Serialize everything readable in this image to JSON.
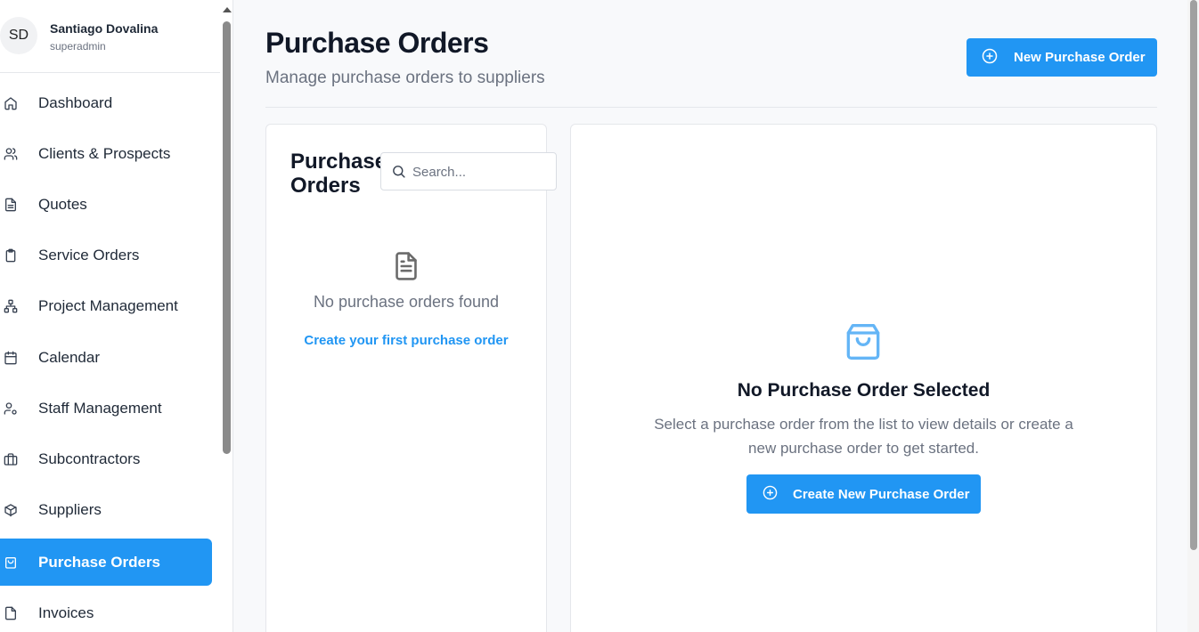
{
  "user": {
    "initials": "SD",
    "name": "Santiago Dovalina",
    "role": "superadmin"
  },
  "nav": [
    {
      "label": "Dashboard",
      "icon": "home-icon",
      "active": false
    },
    {
      "label": "Clients & Prospects",
      "icon": "users-icon",
      "active": false
    },
    {
      "label": "Quotes",
      "icon": "file-text-icon",
      "active": false
    },
    {
      "label": "Service Orders",
      "icon": "clipboard-icon",
      "active": false
    },
    {
      "label": "Project Management",
      "icon": "sitemap-icon",
      "active": false
    },
    {
      "label": "Calendar",
      "icon": "calendar-icon",
      "active": false
    },
    {
      "label": "Staff Management",
      "icon": "user-cog-icon",
      "active": false
    },
    {
      "label": "Subcontractors",
      "icon": "briefcase-icon",
      "active": false
    },
    {
      "label": "Suppliers",
      "icon": "package-icon",
      "active": false
    },
    {
      "label": "Purchase Orders",
      "icon": "shopping-bag-icon",
      "active": true
    },
    {
      "label": "Invoices",
      "icon": "file-icon",
      "active": false
    }
  ],
  "header": {
    "title": "Purchase Orders",
    "subtitle": "Manage purchase orders to suppliers",
    "new_button": "New Purchase Order"
  },
  "list": {
    "title": "Purchase Orders",
    "search_placeholder": "Search...",
    "empty_text": "No purchase orders found",
    "create_link": "Create your first purchase order"
  },
  "detail": {
    "title": "No Purchase Order Selected",
    "description": "Select a purchase order from the list to view details or create a new purchase order to get started.",
    "create_button": "Create New Purchase Order"
  },
  "colors": {
    "accent": "#2196f3",
    "text": "#111827",
    "muted": "#6b7280",
    "border": "#e5e7eb"
  }
}
